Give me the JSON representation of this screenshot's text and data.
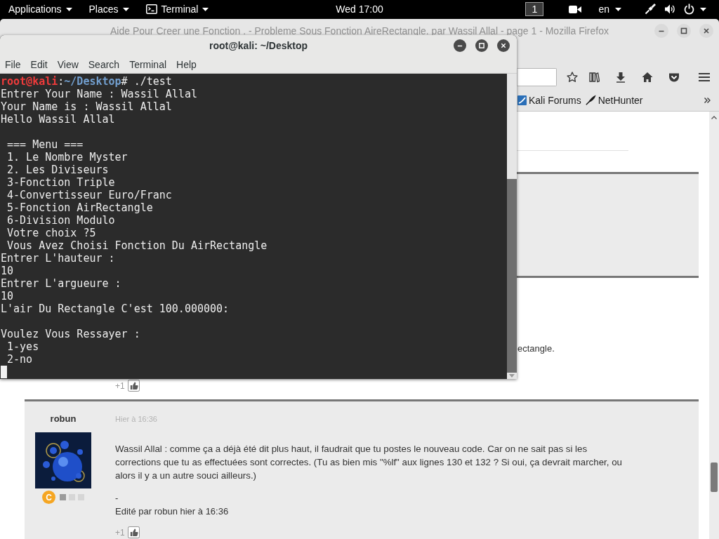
{
  "top_bar": {
    "menus": [
      {
        "label": "Applications",
        "kind": "menu"
      },
      {
        "label": "Places",
        "kind": "menu"
      },
      {
        "label": "Terminal",
        "kind": "app"
      }
    ],
    "clock": "Wed 17:00",
    "workspace": "1",
    "language": "en"
  },
  "browser": {
    "title": "Aide Pour Creer une Fonction . - Probleme Sous Fonction AireRectangle. par Wassil Allal - page 1 - Mozilla Firefox",
    "bookmarks": [
      {
        "label": "Kali Forums",
        "kind": "forum"
      },
      {
        "label": "NetHunter",
        "kind": "tool"
      }
    ],
    "posts": [
      {
        "kind": "covered",
        "shaded": true
      },
      {
        "kind": "covered",
        "shaded": false,
        "message": "ectangle.",
        "likes": "+1"
      },
      {
        "kind": "full",
        "shaded": true,
        "author": "robun",
        "date": "Hier à 16:36",
        "rank_badge": "C",
        "rank_squares": [
          {
            "filled": true
          },
          {
            "filled": false
          },
          {
            "filled": false
          }
        ],
        "message": "Wassil Allal : comme ça a déjà été dit plus haut, il faudrait que tu postes le nouveau code. Car on ne sait pas si les corrections que tu as effectuées sont correctes. (Tu as bien mis \"%lf\" aux lignes 130 et 132 ? Si oui, ça devrait marcher, ou alors il y a un autre souci ailleurs.)",
        "signature": "-",
        "edit_note": "Edité par robun hier à 16:36",
        "likes": "+1"
      }
    ]
  },
  "terminal": {
    "title": "root@kali: ~/Desktop",
    "menus": [
      "File",
      "Edit",
      "View",
      "Search",
      "Terminal",
      "Help"
    ],
    "blocks": [
      {
        "lines": [
          {
            "kind": "prompt",
            "segments": [
              {
                "kind": "user",
                "text": "root@kali"
              },
              {
                "kind": "plain",
                "text": ":"
              },
              {
                "kind": "path",
                "text": "~/Desktop"
              },
              {
                "kind": "plain",
                "text": "# ./test"
              }
            ]
          },
          {
            "kind": "output",
            "text": "Entrer Your Name : Wassil Allal"
          },
          {
            "kind": "output",
            "text": "Your Name is : Wassil Allal"
          },
          {
            "kind": "output",
            "text": "Hello Wassil Allal"
          }
        ]
      },
      {
        "lines": [
          {
            "kind": "output",
            "text": " === Menu ==="
          },
          {
            "kind": "output",
            "text": " 1. Le Nombre Myster"
          },
          {
            "kind": "output",
            "text": " 2. Les Diviseurs"
          },
          {
            "kind": "output",
            "text": " 3-Fonction Triple"
          },
          {
            "kind": "output",
            "text": " 4-Convertisseur Euro/Franc"
          },
          {
            "kind": "output",
            "text": " 5-Fonction AirRectangle"
          },
          {
            "kind": "output",
            "text": " 6-Division Modulo"
          },
          {
            "kind": "output",
            "text": " Votre choix ?5"
          },
          {
            "kind": "output",
            "text": " Vous Avez Choisi Fonction Du AirRectangle"
          },
          {
            "kind": "output",
            "text": "Entrer L'hauteur :"
          },
          {
            "kind": "output",
            "text": "10"
          },
          {
            "kind": "output",
            "text": "Entrer L'argueure :"
          },
          {
            "kind": "output",
            "text": "10"
          },
          {
            "kind": "output",
            "text": "L'air Du Rectangle C'est 100.000000:"
          }
        ]
      },
      {
        "lines": [
          {
            "kind": "output",
            "text": "Voulez Vous Ressayer :"
          },
          {
            "kind": "output",
            "text": " 1-yes"
          },
          {
            "kind": "output",
            "text": " 2-no"
          }
        ]
      }
    ],
    "cursor": true
  }
}
